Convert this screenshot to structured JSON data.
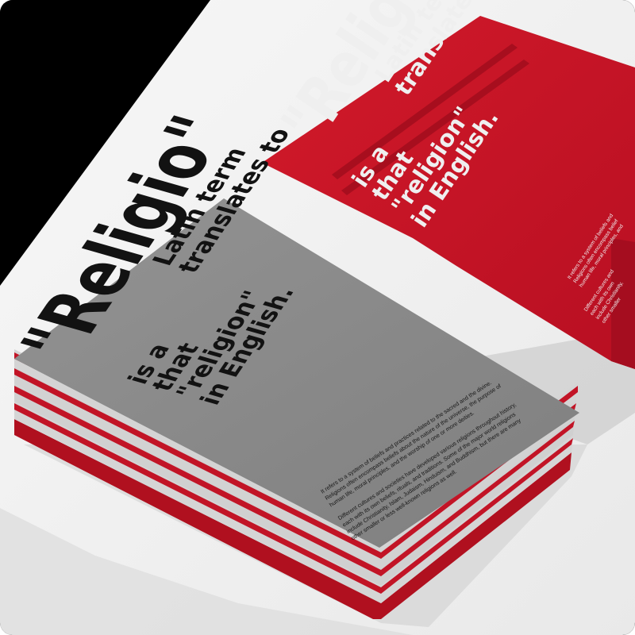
{
  "box": {
    "title": "\"Religio\"",
    "subtitle_lines": [
      "Latin term",
      "translates to"
    ],
    "phrase_lines": [
      "is a",
      "that",
      "\"religion\"",
      "in English."
    ],
    "fine_print": [
      "It refers to a system of beliefs and",
      "Religions often encompass belief",
      "human life, moral principles, and",
      "",
      "Different cultures and",
      "each with its own",
      "include Christianity,",
      "other smaller"
    ]
  },
  "book": {
    "title": "\"Religio\"",
    "subtitle_lines": [
      "Latin term",
      "translates to"
    ],
    "phrase_lines": [
      "is a",
      "that",
      "\"religion\"",
      "in English."
    ],
    "fine_print": [
      "It refers to a system of beliefs and practices related to the sacred and the divine.",
      "Religions often encompass beliefs about the nature of the universe, the purpose of",
      "human life, moral principles, and the worship of one or more deities.",
      "",
      "Different cultures and societies have developed various religions throughout history,",
      "each with its own beliefs, rituals, and traditions. Some of the major world religions",
      "include Christianity, Islam, Judaism, Hinduism, and Buddhism, but there are many",
      "other smaller or less well-known religions as well."
    ]
  },
  "colors": {
    "background": "#000000",
    "table": "#f2f2f2",
    "red": "#c8102e",
    "grey_cover": "#8a8a8a",
    "ink": "#121212",
    "box_text": "#f0f0f0"
  }
}
